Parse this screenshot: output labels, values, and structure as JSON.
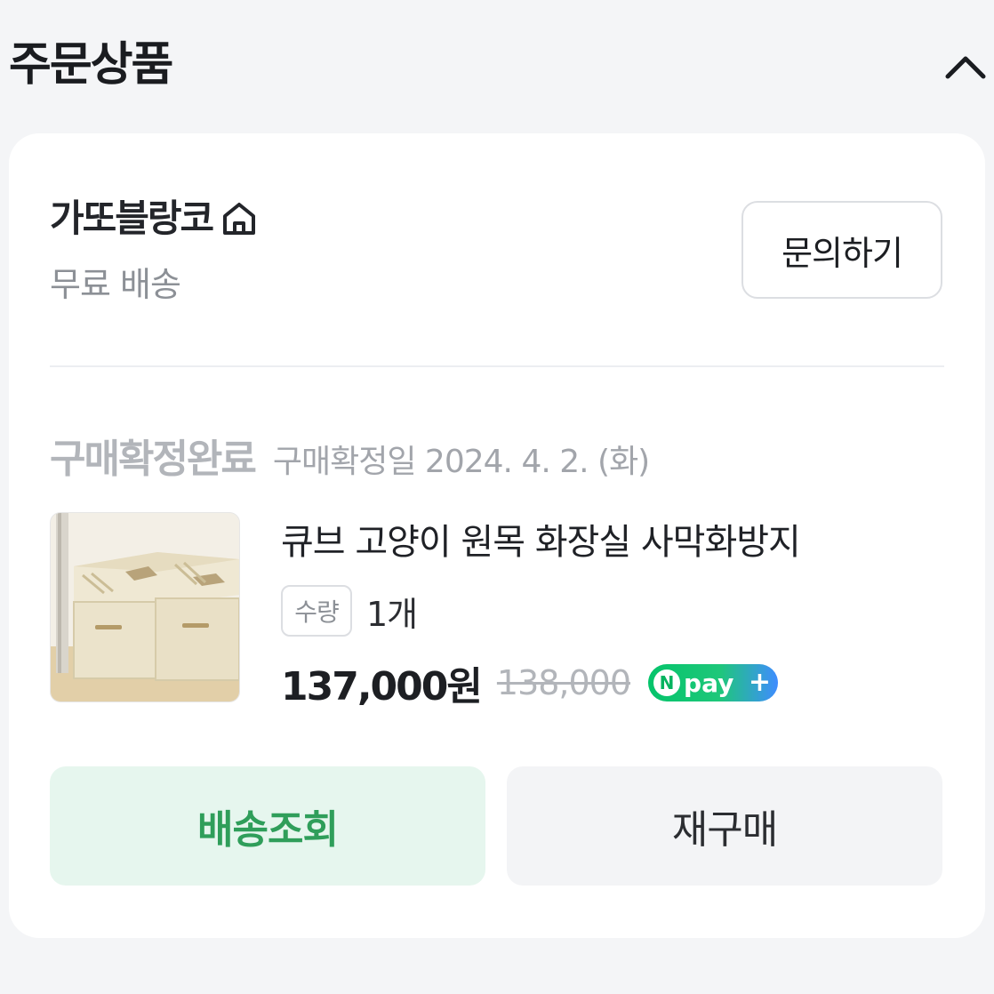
{
  "header": {
    "title": "주문상품",
    "toggle_icon": "chevron-up-icon"
  },
  "seller": {
    "name": "가또블랑코",
    "store_icon": "store-home-icon",
    "shipping": "무료 배송",
    "inquiry_label": "문의하기"
  },
  "order": {
    "status": "구매확정완료",
    "confirm_date": "구매확정일 2024. 4. 2. (화)"
  },
  "product": {
    "name": "큐브 고양이 원목 화장실 사막화방지",
    "qty_label": "수량",
    "qty_value": "1개",
    "sale_price": "137,000원",
    "original_price": "138,000",
    "npay_text": "pay",
    "npay_letter": "N",
    "npay_plus": "+"
  },
  "actions": {
    "track_label": "배송조회",
    "rebuy_label": "재구매"
  },
  "colors": {
    "accent_green": "#2f9e5a",
    "track_bg": "#e6f6ee",
    "page_bg": "#f4f5f7"
  }
}
